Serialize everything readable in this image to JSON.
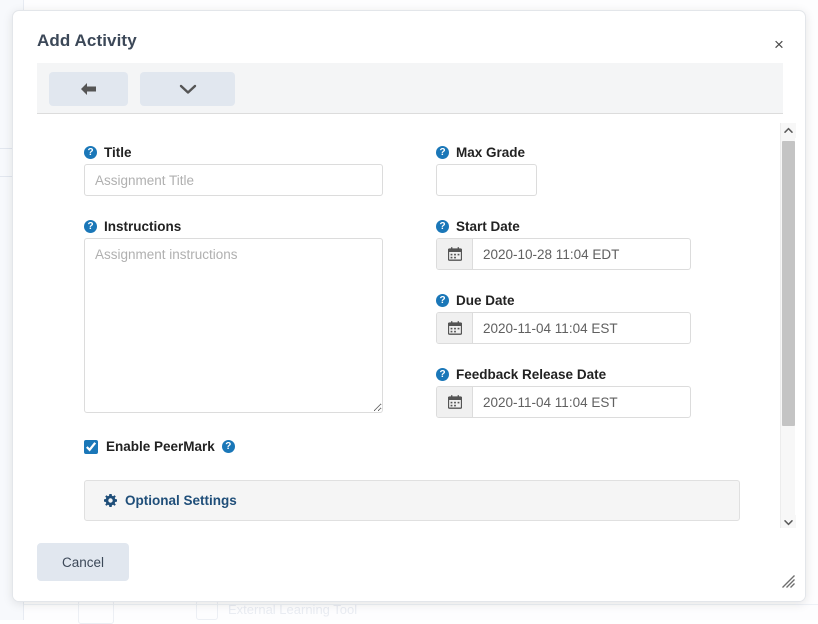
{
  "background": {
    "faint_label": "External Learning Tool"
  },
  "modal": {
    "title": "Add Activity",
    "close_icon": "close-icon",
    "close_label": "×",
    "toolbar": {
      "back_icon": "arrow-left-icon",
      "more_icon": "chevron-down-icon"
    },
    "help_glyph": "?",
    "fields": {
      "title": {
        "label": "Title",
        "value": "",
        "placeholder": "Assignment Title",
        "help_icon": "help-circle-icon"
      },
      "instructions": {
        "label": "Instructions",
        "value": "",
        "placeholder": "Assignment instructions",
        "help_icon": "help-circle-icon"
      },
      "max_grade": {
        "label": "Max Grade",
        "value": "",
        "placeholder": "",
        "help_icon": "help-circle-icon"
      },
      "start_date": {
        "label": "Start Date",
        "value": "2020-10-28 11:04 EDT",
        "calendar_icon": "calendar-icon",
        "help_icon": "help-circle-icon"
      },
      "due_date": {
        "label": "Due Date",
        "value": "2020-11-04 11:04 EST",
        "calendar_icon": "calendar-icon",
        "help_icon": "help-circle-icon"
      },
      "feedback_release_date": {
        "label": "Feedback Release Date",
        "value": "2020-11-04 11:04 EST",
        "calendar_icon": "calendar-icon",
        "help_icon": "help-circle-icon"
      }
    },
    "peermark": {
      "label": "Enable PeerMark",
      "checked": true,
      "help_icon": "help-circle-icon"
    },
    "optional_settings": {
      "label": "Optional Settings",
      "gear_icon": "gear-icon"
    },
    "scrollbar": {
      "up_icon": "chevron-up-icon",
      "down_icon": "chevron-down-icon"
    },
    "footer": {
      "cancel_label": "Cancel",
      "resize_icon": "resize-grip-icon"
    }
  },
  "colors": {
    "help_blue": "#1a77b8",
    "link_navy": "#1f4e79",
    "button_grey_blue": "#e1e7ef",
    "title_slate": "#3c4858"
  }
}
